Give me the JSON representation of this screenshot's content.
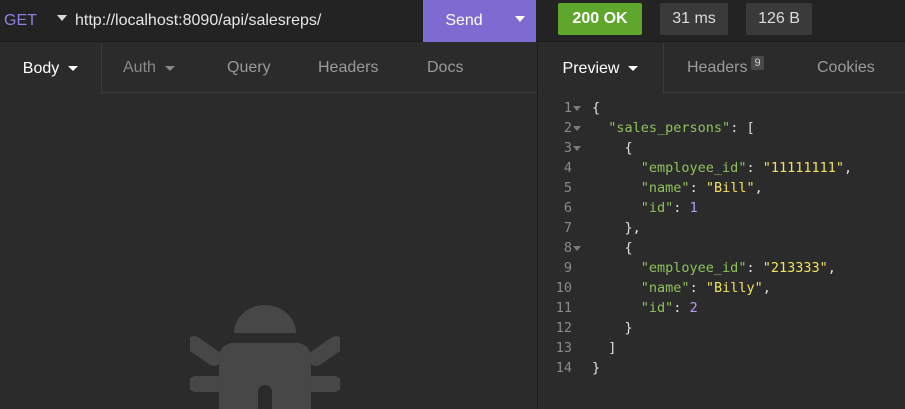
{
  "request": {
    "method": "GET",
    "url": "http://localhost:8090/api/salesreps/",
    "send_label": "Send"
  },
  "response_meta": {
    "status": "200 OK",
    "time": "31 ms",
    "size": "126 B",
    "status_color": "#5ea72c"
  },
  "left_tabs": {
    "body": "Body",
    "auth": "Auth",
    "query": "Query",
    "headers": "Headers",
    "docs": "Docs"
  },
  "right_tabs": {
    "preview": "Preview",
    "headers": "Headers",
    "headers_count": "9",
    "cookies": "Cookies"
  },
  "empty_state_icon": "bug-icon",
  "code_lines": [
    {
      "n": "1",
      "fold": true
    },
    {
      "n": "2",
      "fold": true
    },
    {
      "n": "3",
      "fold": true
    },
    {
      "n": "4",
      "fold": false
    },
    {
      "n": "5",
      "fold": false
    },
    {
      "n": "6",
      "fold": false
    },
    {
      "n": "7",
      "fold": false
    },
    {
      "n": "8",
      "fold": true
    },
    {
      "n": "9",
      "fold": false
    },
    {
      "n": "10",
      "fold": false
    },
    {
      "n": "11",
      "fold": false
    },
    {
      "n": "12",
      "fold": false
    },
    {
      "n": "13",
      "fold": false
    },
    {
      "n": "14",
      "fold": false
    }
  ],
  "json_body": {
    "key_sales_persons": "\"sales_persons\"",
    "key_employee_id": "\"employee_id\"",
    "key_name": "\"name\"",
    "key_id": "\"id\"",
    "p1_employee_id": "\"11111111\"",
    "p1_name": "\"Bill\"",
    "p1_id": "1",
    "p2_employee_id": "\"213333\"",
    "p2_name": "\"Billy\"",
    "p2_id": "2"
  },
  "colors": {
    "accent": "#7e6bd1",
    "json_key": "#8ec25e",
    "json_string": "#f2e15f",
    "json_number": "#b79cf5"
  }
}
